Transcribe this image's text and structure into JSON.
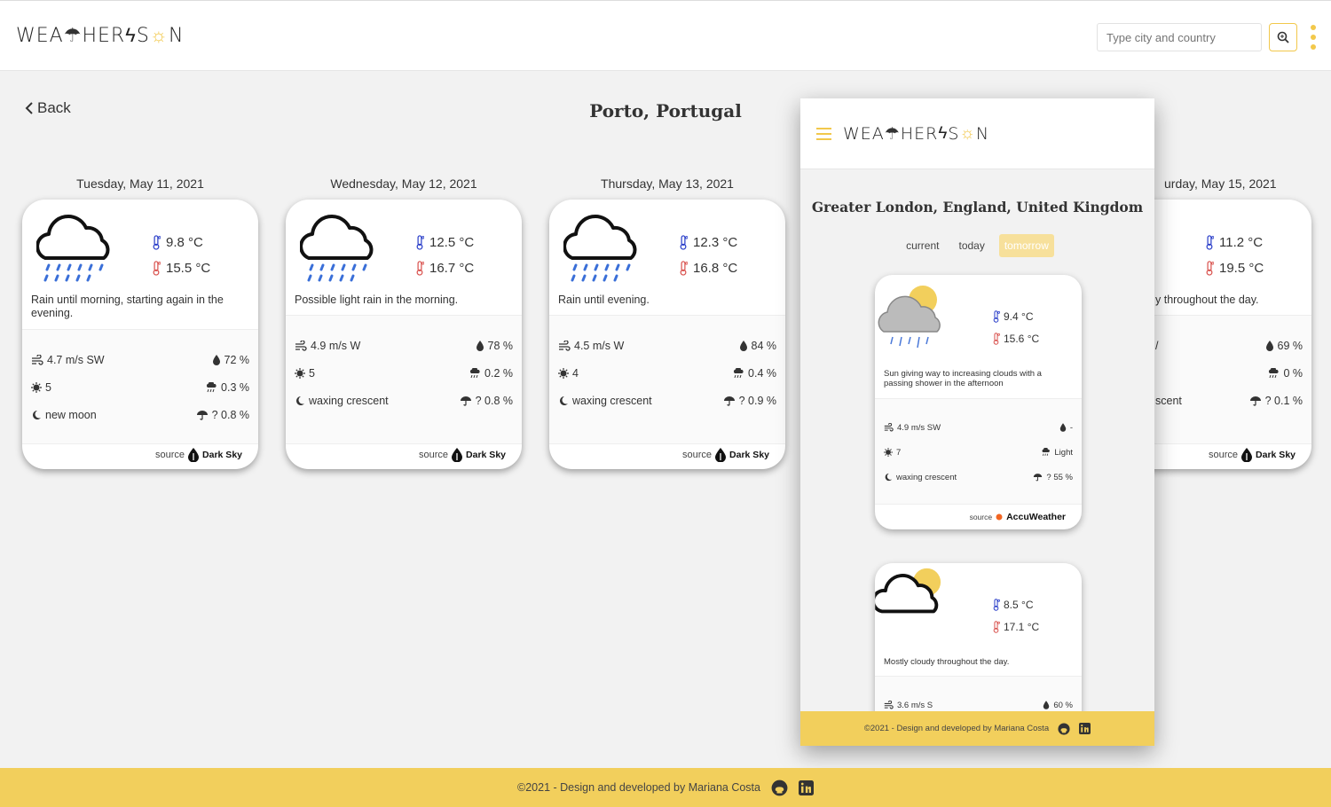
{
  "app": {
    "logo_parts": [
      "WEA",
      "HER",
      "S",
      "N"
    ],
    "search": {
      "placeholder": "Type city and country"
    }
  },
  "page": {
    "back_label": "Back",
    "title": "Porto, Portugal"
  },
  "labels": {
    "source": "source",
    "dark_sky": "Dark Sky",
    "accuweather": "AccuWeather"
  },
  "days": [
    {
      "date": "Tuesday, May 11, 2021",
      "min": "9.8 °C",
      "max": "15.5 °C",
      "summary": "Rain until morning, starting again in the evening.",
      "wind": "4.7 m/s SW",
      "humidity": "72 %",
      "uv": "5",
      "precip": "0.3 %",
      "moon": "new moon",
      "precip_prob": "? 0.8 %",
      "icon": "rain"
    },
    {
      "date": "Wednesday, May 12, 2021",
      "min": "12.5 °C",
      "max": "16.7 °C",
      "summary": "Possible light rain in the morning.",
      "wind": "4.9 m/s W",
      "humidity": "78 %",
      "uv": "5",
      "precip": "0.2 %",
      "moon": "waxing crescent",
      "precip_prob": "? 0.8 %",
      "icon": "rain"
    },
    {
      "date": "Thursday, May 13, 2021",
      "min": "12.3 °C",
      "max": "16.8 °C",
      "summary": "Rain until evening.",
      "wind": "4.5 m/s W",
      "humidity": "84 %",
      "uv": "4",
      "precip": "0.4 %",
      "moon": "waxing crescent",
      "precip_prob": "? 0.9 %",
      "icon": "rain"
    },
    {
      "date": "urday, May 15, 2021",
      "min": "11.2 °C",
      "max": "19.5 °C",
      "summary": "y throughout the day.",
      "wind": "/",
      "humidity": "69 %",
      "uv": "",
      "precip": "0 %",
      "moon": "scent",
      "precip_prob": "? 0.1 %",
      "icon": "partly-cloudy"
    }
  ],
  "overlay": {
    "title": "Greater London, England, United Kingdom",
    "tabs": [
      "current",
      "today",
      "tomorrow"
    ],
    "active_tab": "tomorrow",
    "cards": [
      {
        "min": "9.4 °C",
        "max": "15.6 °C",
        "summary": "Sun giving way to increasing clouds with a passing shower in the afternoon",
        "wind": "4.9 m/s SW",
        "humidity": "-",
        "uv": "7",
        "precip": "Light",
        "moon": "waxing crescent",
        "precip_prob": "? 55 %"
      },
      {
        "min": "8.5 °C",
        "max": "17.1 °C",
        "summary": "Mostly cloudy throughout the day.",
        "wind": "3.6 m/s S",
        "humidity": "60 %"
      }
    ],
    "footer": "©2021 - Design and developed by Mariana Costa"
  },
  "footer": {
    "text": "©2021 - Design and developed by Mariana Costa"
  },
  "colors": {
    "accent": "#f2c84b",
    "footer": "#f2cf5c",
    "cold": "#2b3fc9",
    "hot": "#d9534f"
  }
}
